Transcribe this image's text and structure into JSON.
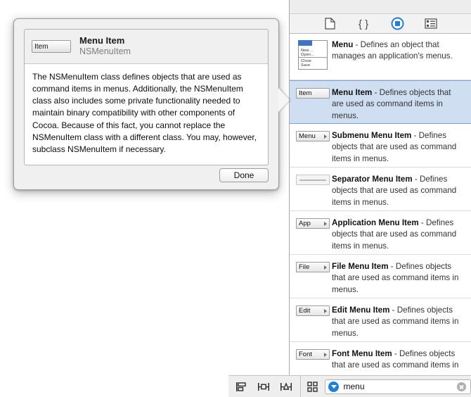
{
  "popover": {
    "thumb_label": "Item",
    "title": "Menu Item",
    "subtitle": "NSMenuItem",
    "body": "The NSMenuItem class defines objects that are used as command items in menus. Additionally, the NSMenuItem class also includes some private functionality needed to maintain binary compatibility with other components of Cocoa. Because of this fact, you cannot replace the NSMenuItem class with a different class. You may, however, subclass NSMenuItem if necessary.",
    "done_label": "Done"
  },
  "library_panel": {
    "tabs": [
      {
        "name": "file-template-library",
        "icon": "file-icon",
        "selected": false
      },
      {
        "name": "code-snippet-library",
        "icon": "braces-icon",
        "selected": false
      },
      {
        "name": "object-library",
        "icon": "object-circle-icon",
        "selected": true
      },
      {
        "name": "media-library",
        "icon": "media-icon",
        "selected": false
      }
    ],
    "selected_accent": "#1f7fe0",
    "selection_fill": "#cfdef1",
    "items": [
      {
        "title": "Menu",
        "description": " - Defines an object that manages an application's menus.",
        "icon": "menu-dropdown-icon",
        "icon_label": "",
        "menu_entries": [
          "New…",
          "Open…",
          "Close",
          "Save"
        ],
        "selected": false
      },
      {
        "title": "Menu Item",
        "description": " - Defines objects that are used as command items in menus.",
        "icon": "menu-item-icon",
        "icon_label": "Item",
        "selected": true
      },
      {
        "title": "Submenu Menu Item",
        "description": " - Defines objects that are used as command items in menus.",
        "icon": "submenu-item-icon",
        "icon_label": "Menu",
        "selected": false
      },
      {
        "title": "Separator Menu Item",
        "description": " - Defines objects that are used as command items in menus.",
        "icon": "separator-item-icon",
        "icon_label": "",
        "selected": false
      },
      {
        "title": "Application Menu Item",
        "description": " - Defines objects that are used as command items in menus.",
        "icon": "app-menu-item-icon",
        "icon_label": "App",
        "selected": false
      },
      {
        "title": "File Menu Item",
        "description": " - Defines objects that are used as command items in menus.",
        "icon": "file-menu-item-icon",
        "icon_label": "File",
        "selected": false
      },
      {
        "title": "Edit Menu Item",
        "description": " - Defines objects that are used as command items in menus.",
        "icon": "edit-menu-item-icon",
        "icon_label": "Edit",
        "selected": false
      },
      {
        "title": "Font Menu Item",
        "description": " - Defines objects that are used as command items in",
        "icon": "font-menu-item-icon",
        "icon_label": "Font",
        "selected": false
      }
    ]
  },
  "bottom_bar": {
    "tools": [
      {
        "name": "align-button",
        "icon": "align-icon"
      },
      {
        "name": "pin-button",
        "icon": "pin-icon"
      },
      {
        "name": "resolve-auto-layout-button",
        "icon": "resolve-auto-layout-icon"
      }
    ],
    "view_mode_icon": "grid-view-icon",
    "search": {
      "value": "menu",
      "placeholder": "",
      "token_icon": "filter-token-icon",
      "clear_icon": "clear-icon"
    }
  }
}
